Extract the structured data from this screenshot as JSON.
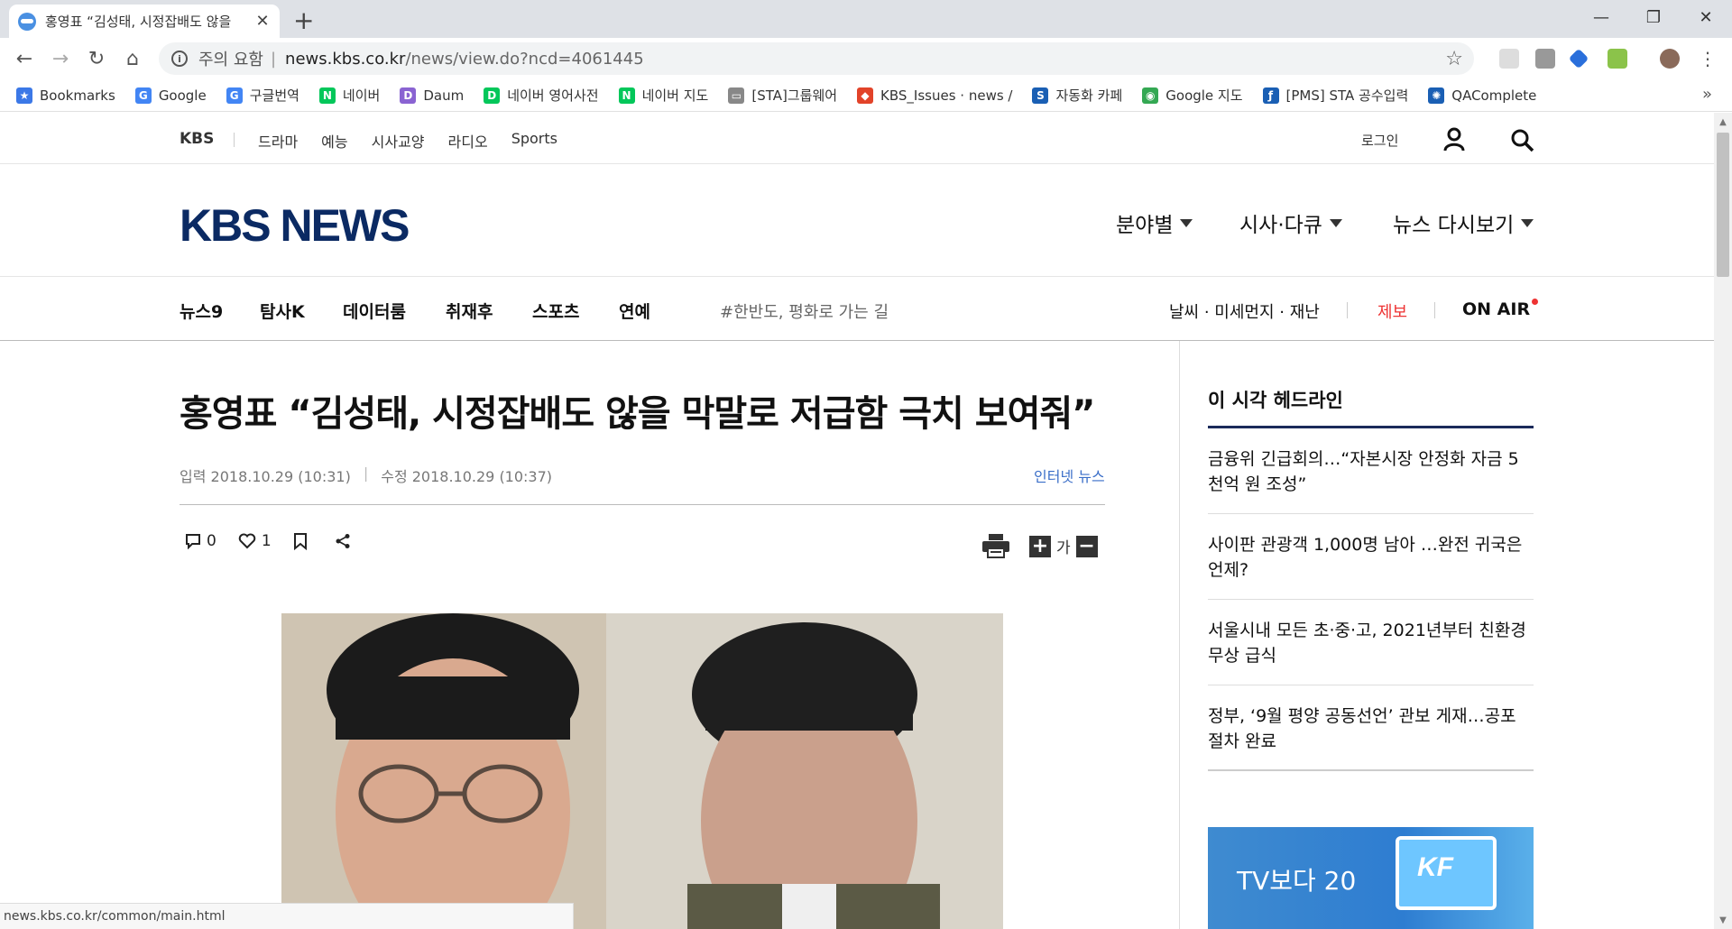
{
  "browser": {
    "tab_title": "홍영표 “김성태, 시정잡배도 않을",
    "security_label": "주의 요함",
    "url_host": "news.kbs.co.kr",
    "url_path": "/news/view.do?ncd=4061445",
    "status_url": "news.kbs.co.kr/common/main.html"
  },
  "bookmarks": [
    {
      "label": "Bookmarks",
      "icon": "star-icon",
      "color": "#3b78e7"
    },
    {
      "label": "Google",
      "icon": "google-icon",
      "color": "#4285f4"
    },
    {
      "label": "구글번역",
      "icon": "translate-icon",
      "color": "#4285f4"
    },
    {
      "label": "네이버",
      "icon": "naver-icon",
      "color": "#03c75a"
    },
    {
      "label": "Daum",
      "icon": "daum-icon",
      "color": "#8a63d2"
    },
    {
      "label": "네이버 영어사전",
      "icon": "dict-icon",
      "color": "#03c75a"
    },
    {
      "label": "네이버 지도",
      "icon": "naver-icon",
      "color": "#03c75a"
    },
    {
      "label": "[STA]그룹웨어",
      "icon": "page-icon",
      "color": "#888888"
    },
    {
      "label": "KBS_Issues · news /",
      "icon": "gitlab-icon",
      "color": "#e24329"
    },
    {
      "label": "자동화 카페",
      "icon": "cafe-icon",
      "color": "#1a5fb4"
    },
    {
      "label": "Google 지도",
      "icon": "maps-icon",
      "color": "#34a853"
    },
    {
      "label": "[PMS] STA 공수입력",
      "icon": "pms-icon",
      "color": "#1a5fb4"
    },
    {
      "label": "QAComplete",
      "icon": "qa-icon",
      "color": "#1a5fb4"
    }
  ],
  "gnb": {
    "kbs": "KBS",
    "links": [
      "드라마",
      "예능",
      "시사교양",
      "라디오",
      "Sports"
    ],
    "login": "로그인"
  },
  "header": {
    "logo": "KBS NEWS",
    "menus": [
      "분야별",
      "시사·다큐",
      "뉴스 다시보기"
    ]
  },
  "subnav": {
    "items": [
      "뉴스9",
      "탐사K",
      "데이터룸",
      "취재후",
      "스포츠",
      "연예"
    ],
    "tag": "#한반도, 평화로 가는 길",
    "weather": "날씨 · 미세먼지 · 재난",
    "jebo": "제보",
    "onair": "ON AIR"
  },
  "article": {
    "title": "홍영표 “김성태, 시정잡배도 않을 막말로 저급함 극치 보여줘”",
    "input_date": "입력 2018.10.29 (10:31)",
    "modified_date": "수정 2018.10.29 (10:37)",
    "category": "인터넷 뉴스",
    "comment_count": "0",
    "like_count": "1",
    "font_label": "가"
  },
  "sidebar": {
    "title": "이 시각 헤드라인",
    "headlines": [
      "금융위 긴급회의…“자본시장 안정화 자금 5천억 원 조성”",
      "사이판 관광객 1,000명 남아 …완전 귀국은 언제?",
      "서울시내 모든 초·중·고, 2021년부터 친환경 무상 급식",
      "정부, ‘9월 평양 공동선언’ 관보 게재…공포 절차 완료"
    ],
    "banner_text": "TV보다 20",
    "banner_logo": "KF"
  }
}
